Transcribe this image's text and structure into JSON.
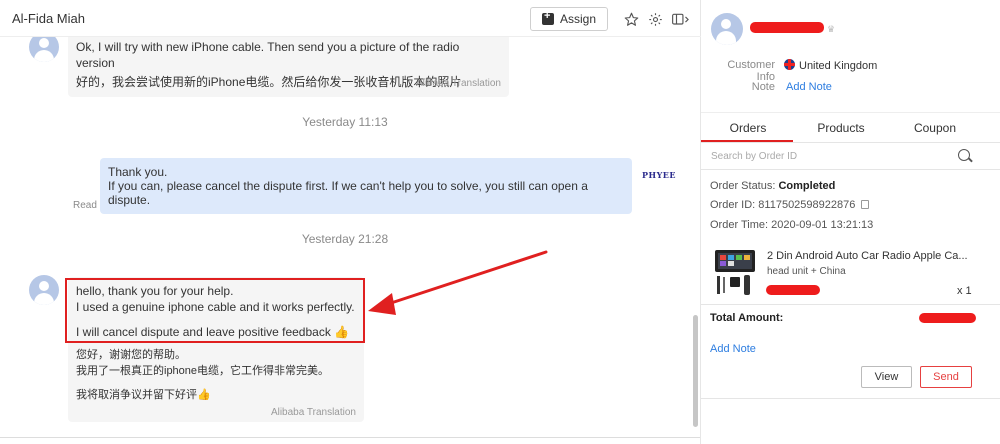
{
  "chat": {
    "title": "Al-Fida Miah",
    "assign_label": "Assign",
    "icons": [
      "star-icon",
      "gear-icon",
      "panel-toggle-icon"
    ],
    "messages": {
      "m1": {
        "text": "Ok, I will try with new iPhone cable. Then send you a picture of the radio version",
        "translation": "好的，我会尝试使用新的iPhone电缆。然后给你发一张收音机版本的照片",
        "translation_source": "Alibaba Translation"
      },
      "time1": "Yesterday 11:13",
      "m2": {
        "line1": "Thank you.",
        "line2": "If you can, please cancel the dispute first. If we can't help you to solve, you still can open a",
        "line3": "dispute.",
        "status": "Read",
        "logo_text": "PHYEE"
      },
      "time2": "Yesterday 21:28",
      "m3": {
        "line1": "hello, thank you for your help.",
        "line2": "I used a genuine iphone cable and it works perfectly.",
        "line3": "I will cancel dispute and leave positive feedback 👍",
        "tr1": "您好，谢谢您的帮助。",
        "tr2": "我用了一根真正的iphone电缆，它工作得非常完美。",
        "tr3": "我将取消争议并留下好评👍",
        "translation_source": "Alibaba Translation"
      }
    }
  },
  "side": {
    "customer_info_label": "Customer Info",
    "country": "United Kingdom",
    "note_label": "Note",
    "add_note_link": "Add Note",
    "tabs": [
      "Orders",
      "Products",
      "Coupon"
    ],
    "active_tab": "Orders",
    "search_placeholder": "Search by Order ID",
    "order": {
      "status_label": "Order Status:",
      "status_value": "Completed",
      "id_label": "Order ID:",
      "id_value": "8117502598922876",
      "time_label": "Order Time:",
      "time_value": "2020-09-01 13:21:13",
      "product_title": "2 Din Android Auto Car Radio Apple Ca...",
      "product_sub": "head unit + China",
      "quantity": "x 1",
      "total_label": "Total Amount:",
      "add_note": "Add Note",
      "view_label": "View",
      "send_label": "Send"
    }
  },
  "colors": {
    "accent_red": "#e02020",
    "link_blue": "#2d7de0",
    "outgoing_bubble": "#dde9fb"
  }
}
